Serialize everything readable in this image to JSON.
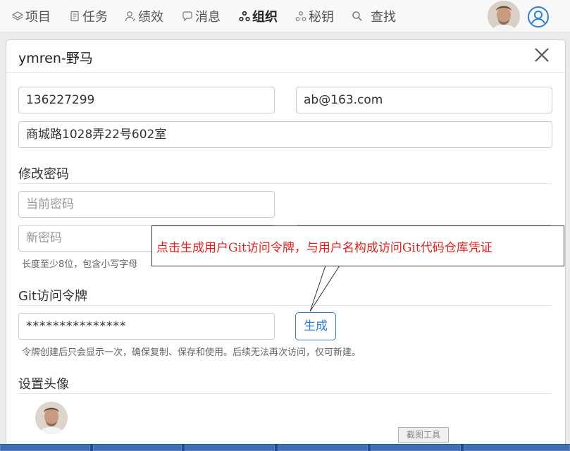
{
  "nav": {
    "items": [
      {
        "label": "项目",
        "icon": "layers-icon"
      },
      {
        "label": "任务",
        "icon": "task-icon"
      },
      {
        "label": "绩效",
        "icon": "user-chart-icon"
      },
      {
        "label": "消息",
        "icon": "chat-icon"
      },
      {
        "label": "组织",
        "icon": "org-icon",
        "active": true
      },
      {
        "label": "秘钥",
        "icon": "key-org-icon"
      },
      {
        "label": "查找",
        "icon": "search-icon"
      }
    ],
    "user_icon": "user-circle-icon"
  },
  "modal": {
    "title": "ymren-野马",
    "phone_value": "136227299",
    "email_value": "ab@163.com",
    "address_value": "商城路1028弄22号602室",
    "password_section": {
      "title": "修改密码",
      "current_placeholder": "当前密码",
      "new_placeholder": "新密码",
      "help": "长度至少8位，包含小写字母"
    },
    "git_section": {
      "title": "Git访问令牌",
      "token_value": "***************",
      "generate_label": "生成",
      "help": "令牌创建后只会显示一次，确保复制、保存和使用。后续无法再次访问，仅可新建。"
    },
    "avatar_section": {
      "title": "设置头像"
    }
  },
  "callout": {
    "text": "点击生成用户Git访问令牌，与用户名构成访问Git代码仓库凭证",
    "color": "#e02020"
  },
  "taskbar": {
    "tooltip": "截图工具"
  },
  "colors": {
    "accent": "#2f7fd6",
    "taskbar": "#1b4f93"
  }
}
